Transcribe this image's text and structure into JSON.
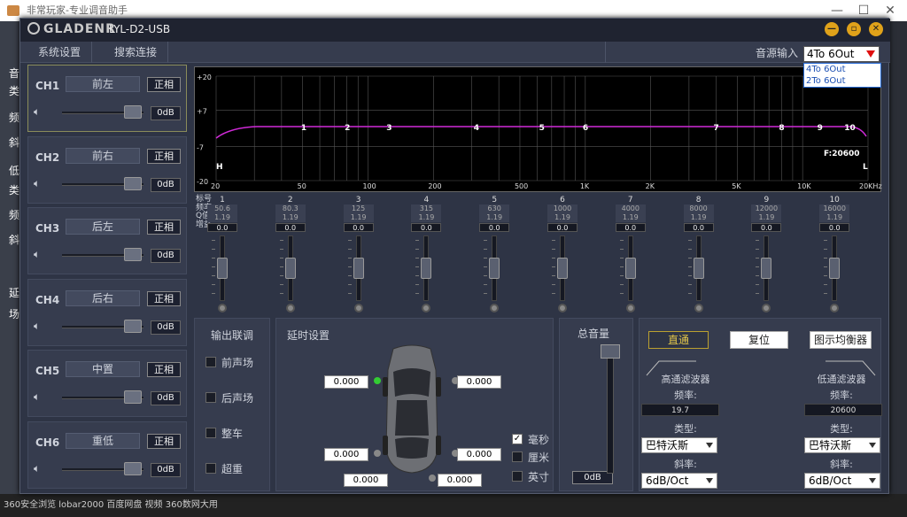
{
  "bg_app": {
    "title": "非常玩家-专业调音助手",
    "taskbar_text": "360安全浏览 lobar2000   百度网盘   视频   360数网大用"
  },
  "bg_left_labels": [
    "音",
    "类",
    "频",
    "斜",
    "低",
    "类",
    "频",
    "斜",
    "延",
    "场"
  ],
  "app": {
    "brand": "GLADENR",
    "model": "LYL-D2-USB"
  },
  "menu": {
    "items": [
      "系统设置",
      "搜索连接"
    ],
    "source_label": "音源输入",
    "source_value": "4To 6Out",
    "source_options": [
      "4To 6Out",
      "2To 6Out"
    ]
  },
  "channels": [
    {
      "id": "CH1",
      "name": "前左",
      "phase": "正相",
      "vol": "0dB"
    },
    {
      "id": "CH2",
      "name": "前右",
      "phase": "正相",
      "vol": "0dB"
    },
    {
      "id": "CH3",
      "name": "后左",
      "phase": "正相",
      "vol": "0dB"
    },
    {
      "id": "CH4",
      "name": "后右",
      "phase": "正相",
      "vol": "0dB"
    },
    {
      "id": "CH5",
      "name": "中置",
      "phase": "正相",
      "vol": "0dB"
    },
    {
      "id": "CH6",
      "name": "重低",
      "phase": "正相",
      "vol": "0dB"
    }
  ],
  "graph": {
    "y_ticks": [
      "+20",
      "+7",
      "-7",
      "-20"
    ],
    "x_ticks": [
      "20",
      "50",
      "100",
      "200",
      "500",
      "1K",
      "2K",
      "5K",
      "10K",
      "20KHz"
    ],
    "band_marks": [
      "1",
      "2",
      "3",
      "4",
      "5",
      "6",
      "7",
      "8",
      "9",
      "10"
    ],
    "h_label": "H",
    "l_label": "L",
    "freq_readout": "F:20600"
  },
  "eq": {
    "header": [
      "标号",
      "频率",
      "Q值",
      "增益"
    ],
    "bands": [
      {
        "n": "1",
        "f": "50.6",
        "q": "1.19",
        "g": "0.0"
      },
      {
        "n": "2",
        "f": "80.3",
        "q": "1.19",
        "g": "0.0"
      },
      {
        "n": "3",
        "f": "125",
        "q": "1.19",
        "g": "0.0"
      },
      {
        "n": "4",
        "f": "315",
        "q": "1.19",
        "g": "0.0"
      },
      {
        "n": "5",
        "f": "630",
        "q": "1.19",
        "g": "0.0"
      },
      {
        "n": "6",
        "f": "1000",
        "q": "1.19",
        "g": "0.0"
      },
      {
        "n": "7",
        "f": "4000",
        "q": "1.19",
        "g": "0.0"
      },
      {
        "n": "8",
        "f": "8000",
        "q": "1.19",
        "g": "0.0"
      },
      {
        "n": "9",
        "f": "12000",
        "q": "1.19",
        "g": "0.0"
      },
      {
        "n": "10",
        "f": "16000",
        "q": "1.19",
        "g": "0.0"
      }
    ]
  },
  "output_link": {
    "title": "输出联调",
    "items": [
      "前声场",
      "后声场",
      "整车",
      "超重"
    ]
  },
  "delay": {
    "title": "延时设置",
    "values": [
      "0.000",
      "0.000",
      "0.000",
      "0.000",
      "0.000",
      "0.000"
    ],
    "units": [
      "毫秒",
      "厘米",
      "英寸"
    ]
  },
  "master": {
    "title": "总音量",
    "value": "0dB"
  },
  "filters": {
    "bypass": "直通",
    "reset": "复位",
    "graphic_eq": "图示均衡器",
    "hp": {
      "title": "高通滤波器",
      "freq_label": "频率:",
      "freq": "19.7",
      "type_label": "类型:",
      "type": "巴特沃斯",
      "slope_label": "斜率:",
      "slope": "6dB/Oct"
    },
    "lp": {
      "title": "低通滤波器",
      "freq_label": "频率:",
      "freq": "20600",
      "type_label": "类型:",
      "type": "巴特沃斯",
      "slope_label": "斜率:",
      "slope": "6dB/Oct"
    }
  },
  "colors": {
    "curve": "#d02ad8",
    "accent": "#e0a21a",
    "bypass": "#e0c44a"
  }
}
